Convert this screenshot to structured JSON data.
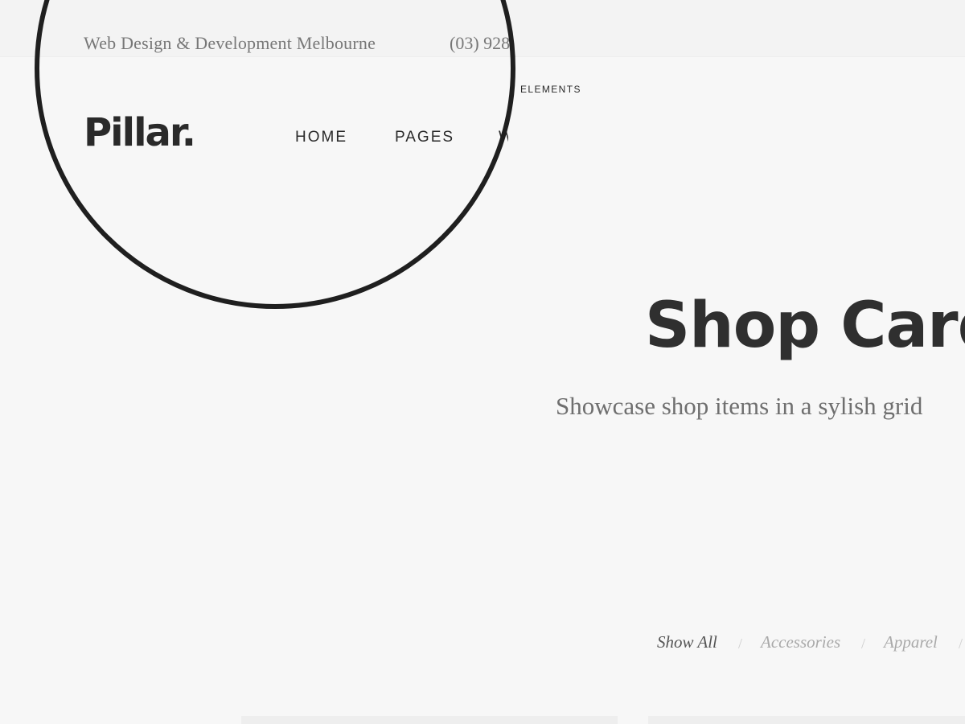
{
  "header": {
    "tagline": "Web Design & Development Melbourne",
    "phone": "(03) 928",
    "elements_menu": "ELEMENTS",
    "logo": "Pillar.",
    "nav": [
      "HOME",
      "PAGES",
      "W"
    ]
  },
  "hero": {
    "title": "Shop Card",
    "subtitle": "Showcase shop items in a sylish grid"
  },
  "filters": {
    "items": [
      "Show All",
      "Accessories",
      "Apparel"
    ],
    "separator": "/",
    "active": "Show All"
  },
  "colors": {
    "background": "#f7f7f7",
    "text_dark": "#2a2a2a",
    "magnifier_ring": "#1f1f1f"
  }
}
